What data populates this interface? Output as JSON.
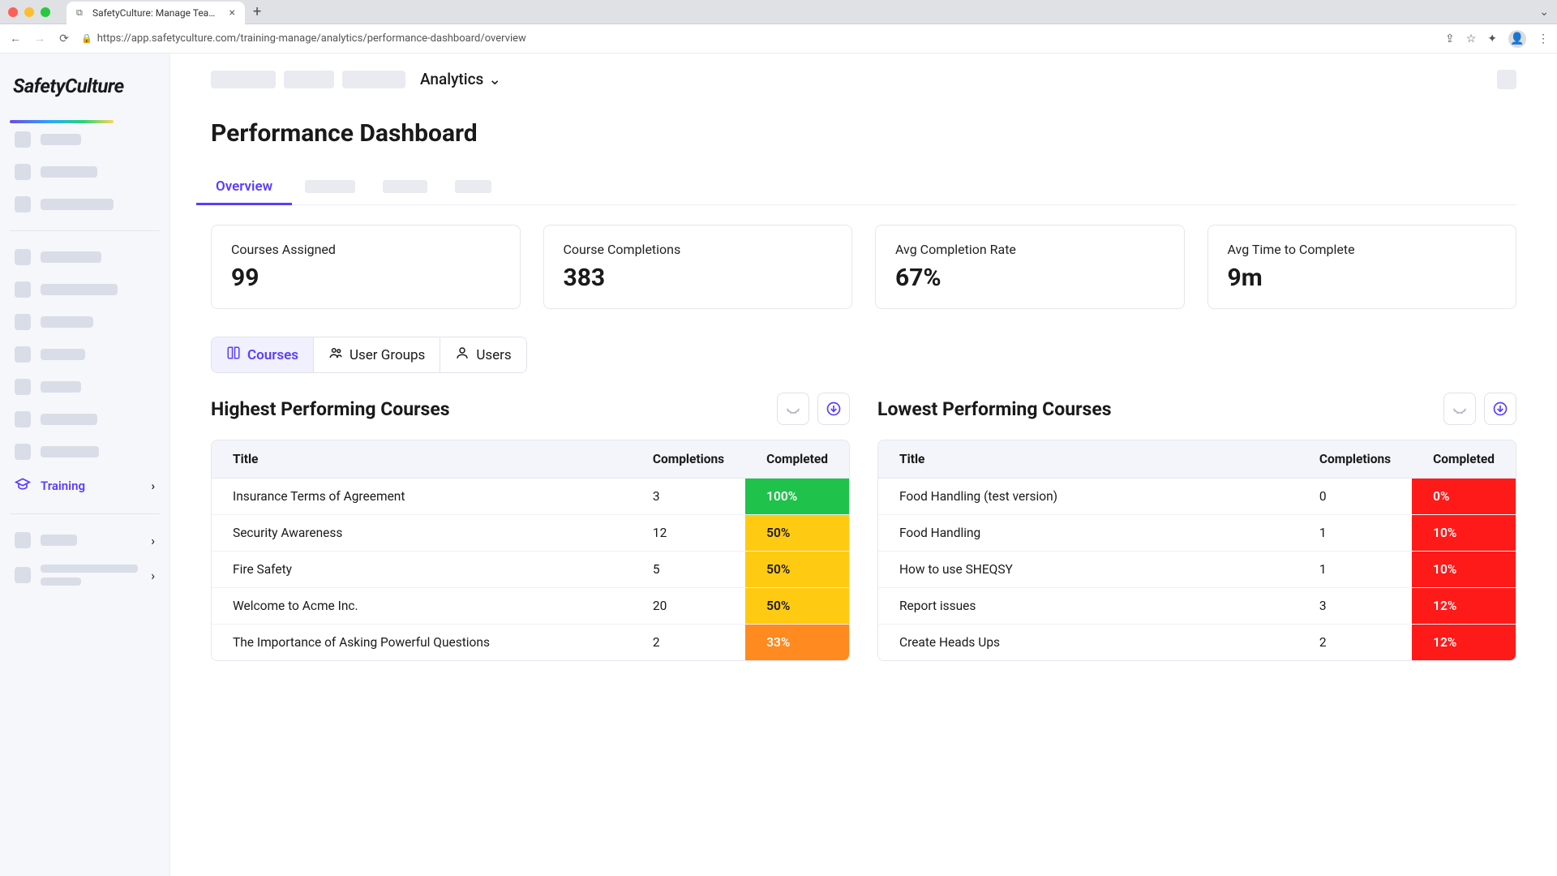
{
  "browser": {
    "tab_title": "SafetyCulture: Manage Teams and ...",
    "url": "https://app.safetyculture.com/training-manage/analytics/performance-dashboard/overview"
  },
  "logo_text": "SafetyCulture",
  "sidebar": {
    "training_label": "Training"
  },
  "topbar": {
    "dropdown_label": "Analytics"
  },
  "page_title": "Performance Dashboard",
  "tabs": {
    "overview": "Overview"
  },
  "stats": [
    {
      "label": "Courses Assigned",
      "value": "99"
    },
    {
      "label": "Course Completions",
      "value": "383"
    },
    {
      "label": "Avg Completion Rate",
      "value": "67%"
    },
    {
      "label": "Avg Time to Complete",
      "value": "9m"
    }
  ],
  "segments": {
    "courses": "Courses",
    "user_groups": "User Groups",
    "users": "Users"
  },
  "panels": {
    "highest_title": "Highest Performing Courses",
    "lowest_title": "Lowest Performing Courses",
    "col_title": "Title",
    "col_completions": "Completions",
    "col_completed": "Completed"
  },
  "highest": [
    {
      "title": "Insurance Terms of Agreement",
      "completions": "3",
      "completed": "100%",
      "cls": "green"
    },
    {
      "title": "Security Awareness",
      "completions": "12",
      "completed": "50%",
      "cls": "yellow"
    },
    {
      "title": "Fire Safety",
      "completions": "5",
      "completed": "50%",
      "cls": "yellow"
    },
    {
      "title": "Welcome to Acme Inc.",
      "completions": "20",
      "completed": "50%",
      "cls": "yellow"
    },
    {
      "title": "The Importance of Asking Powerful Questions",
      "completions": "2",
      "completed": "33%",
      "cls": "orange"
    }
  ],
  "lowest": [
    {
      "title": "Food Handling (test version)",
      "completions": "0",
      "completed": "0%",
      "cls": "red"
    },
    {
      "title": "Food Handling",
      "completions": "1",
      "completed": "10%",
      "cls": "red"
    },
    {
      "title": "How to use SHEQSY",
      "completions": "1",
      "completed": "10%",
      "cls": "red"
    },
    {
      "title": "Report issues",
      "completions": "3",
      "completed": "12%",
      "cls": "red"
    },
    {
      "title": "Create Heads Ups",
      "completions": "2",
      "completed": "12%",
      "cls": "red"
    }
  ]
}
